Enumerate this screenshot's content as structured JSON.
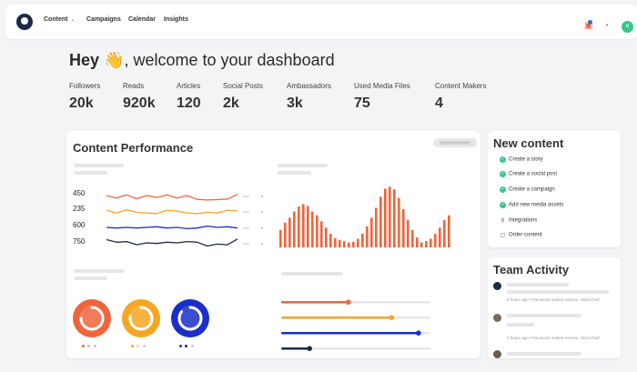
{
  "nav": {
    "items": [
      {
        "label": "Content",
        "caret": "⌄"
      },
      {
        "label": "Campaigns"
      },
      {
        "label": "Calendar"
      },
      {
        "label": "Insights"
      }
    ],
    "avatar_initial": "c"
  },
  "greeting": {
    "prefix": "Hey",
    "emoji": "👋",
    "rest": ", welcome to your dashboard"
  },
  "stats": [
    {
      "label": "Followers",
      "value": "20k"
    },
    {
      "label": "Reads",
      "value": "920k"
    },
    {
      "label": "Articles",
      "value": "120"
    },
    {
      "label": "Social Posts",
      "value": "2k"
    },
    {
      "label": "Ambassadors",
      "value": "3k"
    },
    {
      "label": "Used Media Files",
      "value": "75"
    },
    {
      "label": "Content Makers",
      "value": "4"
    }
  ],
  "performance": {
    "title": "Content Performance",
    "line_labels": [
      "450",
      "235",
      "600",
      "750"
    ],
    "line_colors": [
      "#f0643c",
      "#f5a623",
      "#1a2fc8",
      "#1a2b45"
    ],
    "line_series": [
      [
        0.5,
        0.3,
        0.55,
        0.25,
        0.5,
        0.35,
        0.55,
        0.3,
        0.5,
        0.2,
        0.15,
        0.18,
        0.22,
        0.6
      ],
      [
        0.55,
        0.35,
        0.6,
        0.4,
        0.35,
        0.3,
        0.55,
        0.5,
        0.35,
        0.3,
        0.4,
        0.35,
        0.55,
        0.5
      ],
      [
        0.5,
        0.45,
        0.5,
        0.45,
        0.5,
        0.55,
        0.45,
        0.5,
        0.4,
        0.45,
        0.6,
        0.5,
        0.55,
        0.45
      ],
      [
        0.75,
        0.55,
        0.6,
        0.35,
        0.5,
        0.45,
        0.55,
        0.5,
        0.6,
        0.55,
        0.25,
        0.4,
        0.35,
        0.8
      ]
    ],
    "bar_color": "#f0643c",
    "bar_values": [
      0.28,
      0.4,
      0.48,
      0.58,
      0.66,
      0.7,
      0.67,
      0.58,
      0.52,
      0.42,
      0.32,
      0.22,
      0.15,
      0.12,
      0.1,
      0.08,
      0.09,
      0.14,
      0.22,
      0.34,
      0.48,
      0.64,
      0.82,
      0.95,
      0.98,
      0.94,
      0.8,
      0.62,
      0.44,
      0.28,
      0.16,
      0.08,
      0.1,
      0.14,
      0.22,
      0.32,
      0.44,
      0.52
    ],
    "rings": [
      {
        "color": "#f0643c",
        "progress": 0.75
      },
      {
        "color": "#f5a623",
        "progress": 0.78
      },
      {
        "color": "#1a2fc8",
        "progress": 0.85
      }
    ],
    "sliders": [
      {
        "color": "#f0643c",
        "progress": 0.45
      },
      {
        "color": "#f5a623",
        "progress": 0.74
      },
      {
        "color": "#1a2fc8",
        "progress": 0.92
      },
      {
        "color": "#1a2b45",
        "progress": 0.19
      }
    ]
  },
  "new_content": {
    "title": "New content",
    "items": [
      {
        "icon": "check-icon",
        "label": "Create a story"
      },
      {
        "icon": "check-icon",
        "label": "Create a social post"
      },
      {
        "icon": "check-icon",
        "label": "Create a campaign"
      },
      {
        "icon": "check-icon",
        "label": "Add new media assets"
      },
      {
        "icon": "plug-icon",
        "label": "Integrations"
      },
      {
        "icon": "box-icon",
        "label": "Order content"
      }
    ]
  },
  "team_activity": {
    "title": "Team Activity",
    "entries": [
      {
        "meta": "8 hours ago • Facebook Instant Articles, StoryChief"
      },
      {
        "meta": "8 hours ago • Facebook Instant Articles, StoryChief"
      }
    ]
  }
}
